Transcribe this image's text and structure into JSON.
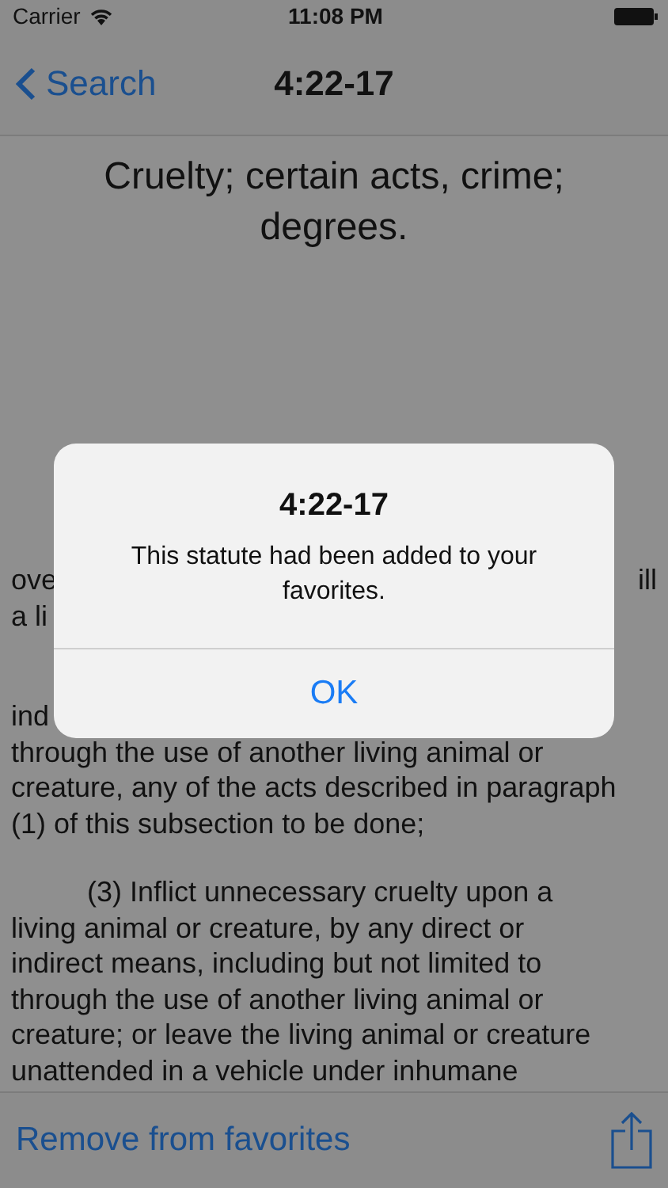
{
  "status_bar": {
    "carrier": "Carrier",
    "time": "11:08 PM"
  },
  "nav": {
    "back": "Search",
    "title": "4:22-17"
  },
  "statute": {
    "title": "Cruelty; certain acts, crime; degrees.",
    "fragments": [
      {
        "left": "ove",
        "right": "ill"
      },
      {
        "left": "a li"
      },
      {
        "left": "ind"
      }
    ],
    "paragraphs": [
      {
        "kind": "plain",
        "text": "through the use of another living animal or creature, any of the acts described in paragraph (1) of this subsection to be done;"
      },
      {
        "kind": "indented",
        "text": "(3)  Inflict unnecessary cruelty upon a living animal or creature, by any direct or indirect means, including but not limited to through the use of another living animal or creature; or leave the living animal or creature unattended in a vehicle under inhumane"
      }
    ]
  },
  "alert": {
    "title": "4:22-17",
    "message": "This statute had been added to your favorites.",
    "button": "OK"
  },
  "toolbar": {
    "action": "Remove from favorites"
  }
}
